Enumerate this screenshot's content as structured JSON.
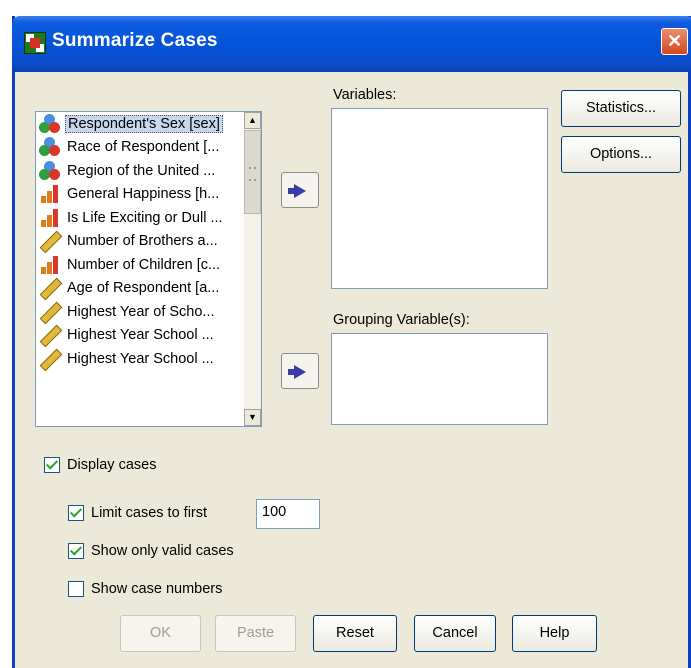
{
  "window": {
    "title": "Summarize Cases",
    "close_symbol": "✕",
    "accent_color": "#0a3fbf"
  },
  "variable_list": {
    "items": [
      {
        "label": "Respondent's Sex [sex]",
        "icon": "nominal-icon"
      },
      {
        "label": "Race of Respondent [...",
        "icon": "nominal-icon"
      },
      {
        "label": "Region of the United ...",
        "icon": "nominal-icon"
      },
      {
        "label": "General Happiness [h...",
        "icon": "ordinal-icon"
      },
      {
        "label": "Is Life Exciting or Dull ...",
        "icon": "ordinal-icon"
      },
      {
        "label": "Number of Brothers a...",
        "icon": "scale-icon"
      },
      {
        "label": "Number of Children [c...",
        "icon": "ordinal-icon"
      },
      {
        "label": "Age of Respondent [a...",
        "icon": "scale-icon"
      },
      {
        "label": "Highest Year of Scho...",
        "icon": "scale-icon"
      },
      {
        "label": "Highest Year School ...",
        "icon": "scale-icon"
      },
      {
        "label": "Highest Year School ...",
        "icon": "scale-icon"
      }
    ]
  },
  "variables": {
    "label": "Variables:"
  },
  "grouping": {
    "label": "Grouping Variable(s):"
  },
  "side_buttons": {
    "statistics": "Statistics...",
    "options": "Options..."
  },
  "options": {
    "display_cases": {
      "label": "Display cases",
      "checked": true
    },
    "limit_cases": {
      "label": "Limit cases to first",
      "checked": true,
      "value": "100"
    },
    "valid_only": {
      "label": "Show only valid cases",
      "checked": true
    },
    "case_numbers": {
      "label": "Show case numbers",
      "checked": false
    }
  },
  "bottom_buttons": {
    "ok": "OK",
    "paste": "Paste",
    "reset": "Reset",
    "cancel": "Cancel",
    "help": "Help"
  }
}
